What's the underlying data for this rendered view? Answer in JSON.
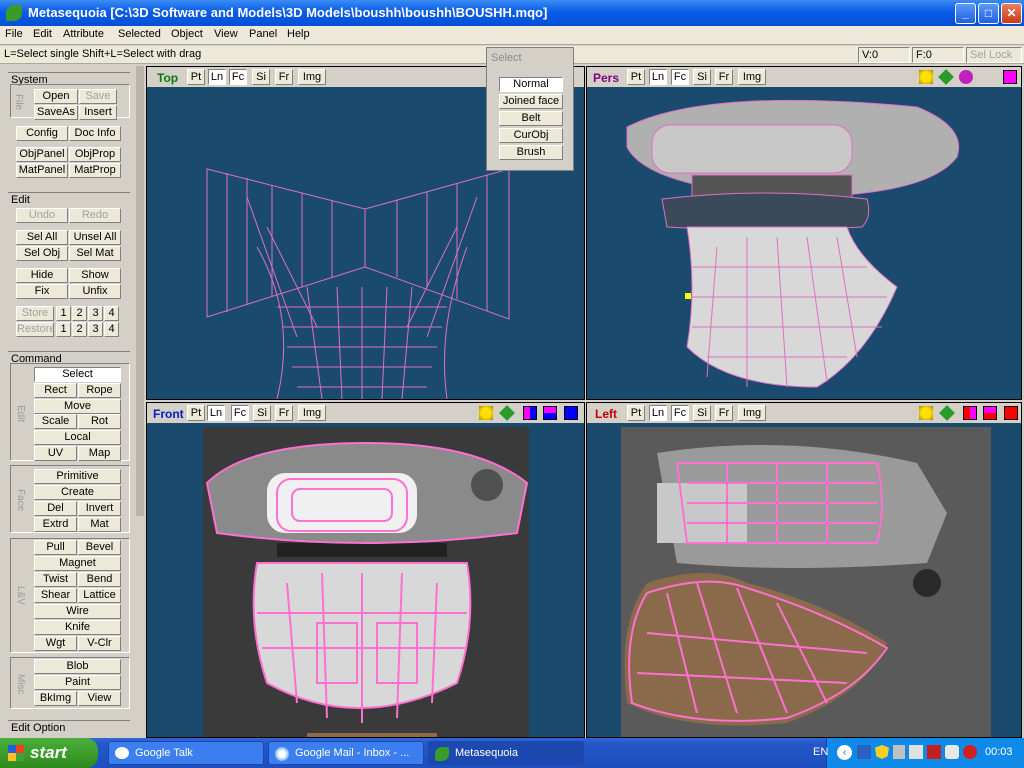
{
  "window": {
    "title": "Metasequoia [C:\\3D Software and Models\\3D Models\\boushh\\boushh\\BOUSHH.mqo]",
    "min": "_",
    "max": "□",
    "close": "✕"
  },
  "menu": [
    "File",
    "Edit",
    "Attribute",
    "Selected",
    "Object",
    "View",
    "Panel",
    "Help"
  ],
  "status": {
    "hint": "L=Select single  Shift+L=Select with drag",
    "v": "V:0",
    "f": "F:0",
    "sel_lock": "Sel Lock"
  },
  "panel": {
    "system": {
      "title": "System",
      "file_label": "File",
      "open": "Open",
      "save": "Save",
      "saveas": "SaveAs",
      "insert": "Insert",
      "config": "Config",
      "docinfo": "Doc Info",
      "objpanel": "ObjPanel",
      "objprop": "ObjProp",
      "matpanel": "MatPanel",
      "matprop": "MatProp"
    },
    "edit": {
      "title": "Edit",
      "undo": "Undo",
      "redo": "Redo",
      "selall": "Sel All",
      "unselall": "Unsel All",
      "selobj": "Sel Obj",
      "selmat": "Sel Mat",
      "hide": "Hide",
      "show": "Show",
      "fix": "Fix",
      "unfix": "Unfix",
      "store": "Store",
      "restore": "Restore",
      "n1": "1",
      "n2": "2",
      "n3": "3",
      "n4": "4"
    },
    "command": {
      "title": "Command",
      "edit_label": "Edit",
      "select": "Select",
      "rect": "Rect",
      "rope": "Rope",
      "move": "Move",
      "scale": "Scale",
      "rot": "Rot",
      "local": "Local",
      "uv": "UV",
      "map": "Map",
      "face_label": "Face",
      "primitive": "Primitive",
      "create": "Create",
      "del": "Del",
      "invert": "Invert",
      "extrd": "Extrd",
      "mat": "Mat",
      "lv_label": "L&V",
      "pull": "Pull",
      "bevel": "Bevel",
      "magnet": "Magnet",
      "twist": "Twist",
      "bend": "Bend",
      "shear": "Shear",
      "lattice": "Lattice",
      "wire": "Wire",
      "knife": "Knife",
      "wgt": "Wgt",
      "vclr": "V-Clr",
      "misc_label": "Misc",
      "blob": "Blob",
      "paint": "Paint",
      "bkimg": "BkImg",
      "view": "View"
    },
    "editoption": {
      "title": "Edit Option"
    }
  },
  "viewports": {
    "top": {
      "name": "Top"
    },
    "pers": {
      "name": "Pers"
    },
    "front": {
      "name": "Front"
    },
    "left": {
      "name": "Left"
    },
    "buttons": {
      "pt": "Pt",
      "ln": "Ln",
      "fc": "Fc",
      "si": "Si",
      "fr": "Fr",
      "img": "Img"
    }
  },
  "select_popup": {
    "title": "Select",
    "items": [
      "Normal",
      "Joined face",
      "Belt",
      "CurObj",
      "Brush"
    ]
  },
  "taskbar": {
    "start": "start",
    "tasks": [
      "Google Talk",
      "Google Mail - Inbox - ...",
      "Metasequoia"
    ],
    "lang": "EN",
    "clock": "00:03"
  },
  "colors": {
    "viewport_bg": "#1a4a6e",
    "wire": "#e070c0",
    "title_blue": "#0a5ce6"
  }
}
